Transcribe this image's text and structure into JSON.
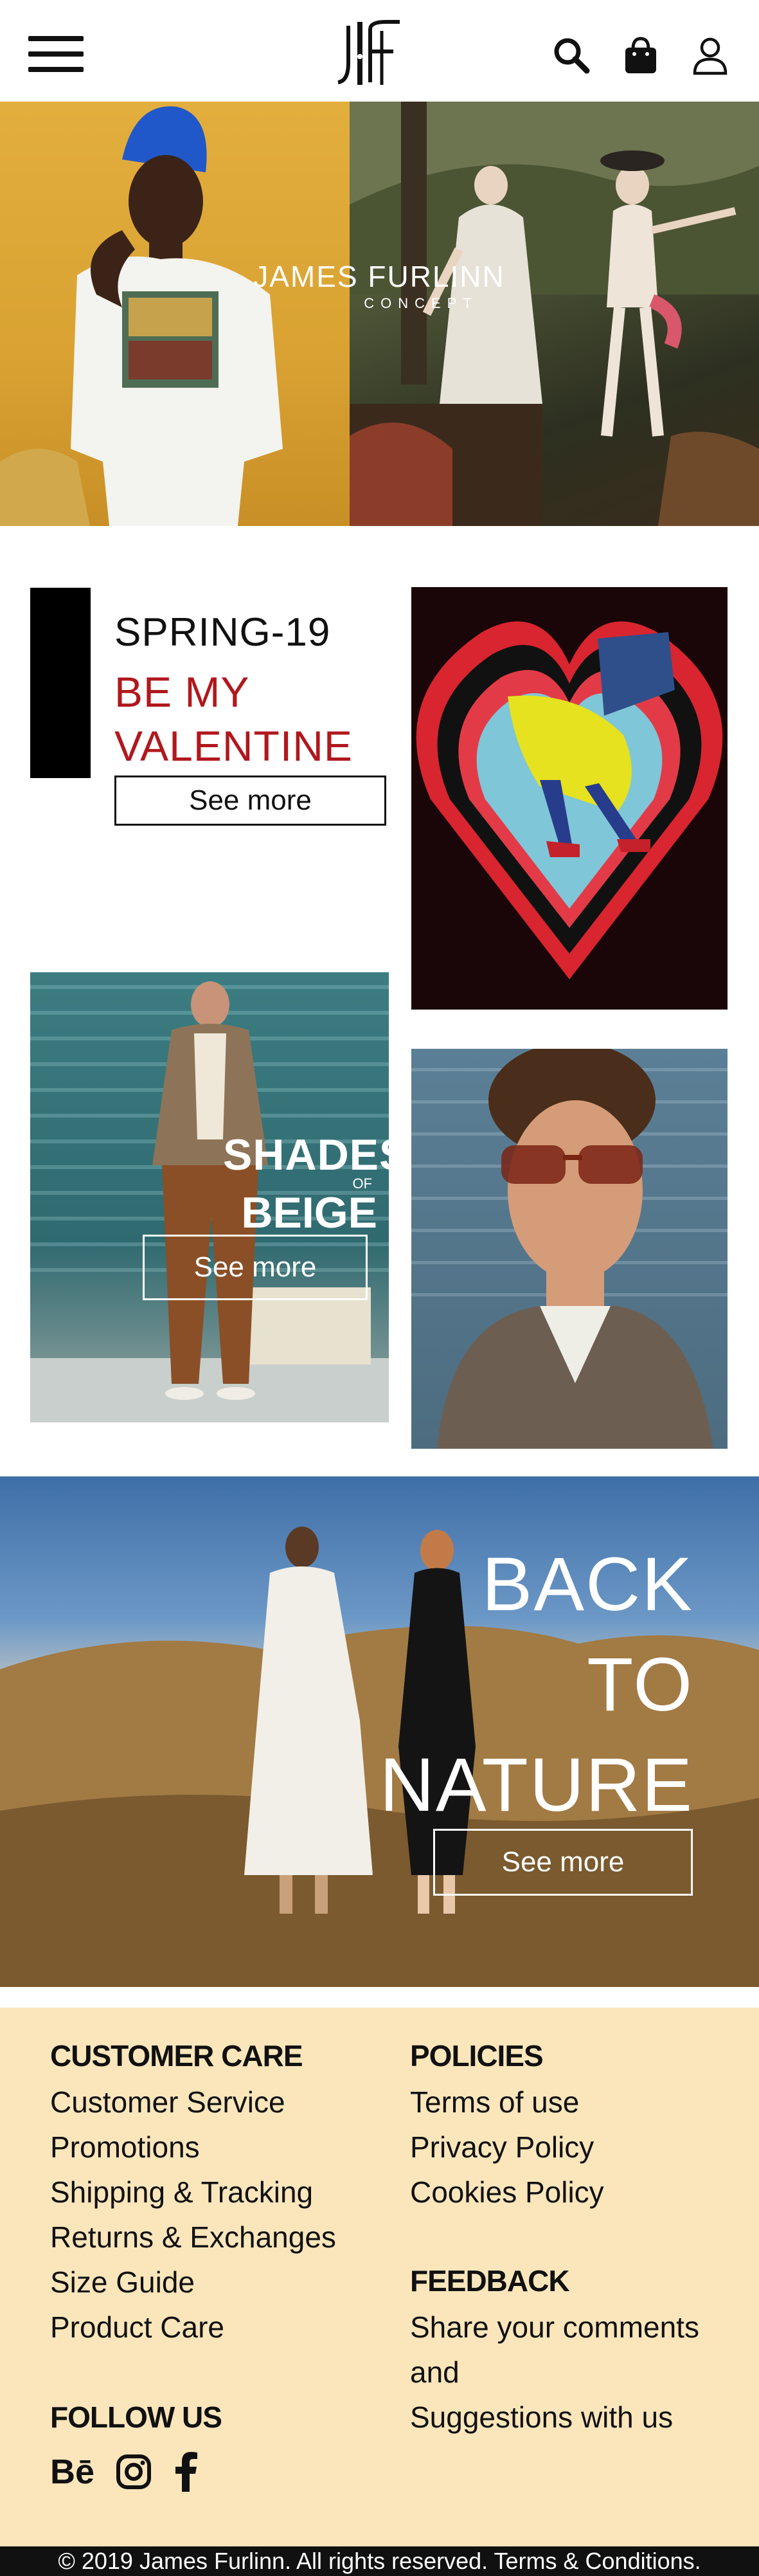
{
  "header": {
    "menu_icon": "hamburger-menu-icon",
    "logo_text": "JF",
    "icons": [
      "search-icon",
      "shopping-bag-icon",
      "user-icon"
    ]
  },
  "hero": {
    "brand_name": "JAMES FURLINN",
    "brand_sub": "CONCEPT"
  },
  "promo_spring": {
    "season": "SPRING-19",
    "headline_line1": "BE MY",
    "headline_line2": "VALENTINE",
    "button": "See more"
  },
  "promo_shades": {
    "title_line1": "SHADES",
    "title_of": "OF",
    "title_line2": "BEIGE",
    "button": "See more"
  },
  "promo_nature": {
    "line1": "BACK",
    "line2": "TO",
    "line3": "NATURE",
    "button": "See more"
  },
  "footer": {
    "customer_care": {
      "heading": "CUSTOMER CARE",
      "links": [
        "Customer Service",
        "Promotions",
        "Shipping & Tracking",
        "Returns & Exchanges",
        "Size Guide",
        "Product Care"
      ]
    },
    "policies": {
      "heading": "POLICIES",
      "links": [
        "Terms of use",
        "Privacy Policy",
        "Cookies Policy"
      ]
    },
    "feedback": {
      "heading": "FEEDBACK",
      "lines": [
        "Share your comments",
        "and",
        "Suggestions with us"
      ]
    },
    "follow": {
      "heading": "FOLLOW US",
      "icons": [
        "behance-icon",
        "instagram-icon",
        "facebook-icon"
      ],
      "behance_text": "Bē"
    },
    "copyright": "© 2019 James Furlinn. All rights reserved. Terms & Conditions."
  }
}
